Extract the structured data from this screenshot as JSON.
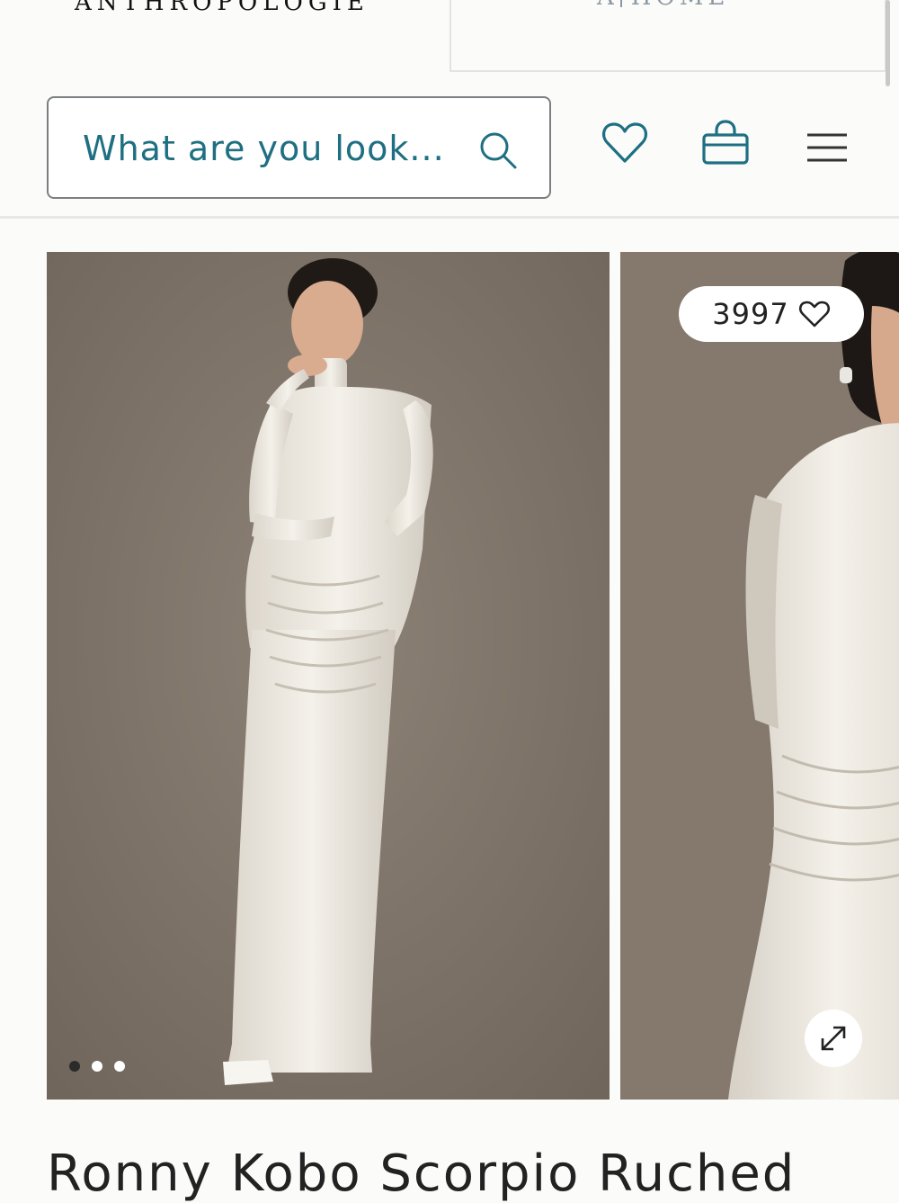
{
  "brand": {
    "name": "ANTHROPOLOGIE",
    "home_prefix": "A",
    "home_label": "HOME"
  },
  "header": {
    "search_placeholder": "What are you look...",
    "icons": [
      "search-icon",
      "heart-icon",
      "shopping-bag-icon",
      "hamburger-menu-icon"
    ],
    "accent_color": "#1f6f82"
  },
  "gallery": {
    "like_count": "3997",
    "dots_total": 3,
    "active_dot": 1,
    "icons": [
      "heart-outline-icon",
      "expand-icon"
    ]
  },
  "product": {
    "title": "Ronny Kobo Scorpio Ruched"
  }
}
